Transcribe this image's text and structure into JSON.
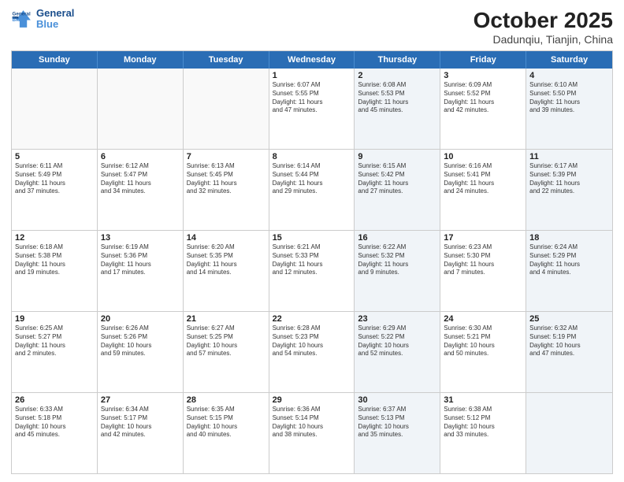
{
  "header": {
    "logo_line1": "General",
    "logo_line2": "Blue",
    "month": "October 2025",
    "location": "Dadunqiu, Tianjin, China"
  },
  "weekdays": [
    "Sunday",
    "Monday",
    "Tuesday",
    "Wednesday",
    "Thursday",
    "Friday",
    "Saturday"
  ],
  "rows": [
    [
      {
        "day": "",
        "info": "",
        "shaded": false,
        "empty": true
      },
      {
        "day": "",
        "info": "",
        "shaded": false,
        "empty": true
      },
      {
        "day": "",
        "info": "",
        "shaded": false,
        "empty": true
      },
      {
        "day": "1",
        "info": "Sunrise: 6:07 AM\nSunset: 5:55 PM\nDaylight: 11 hours\nand 47 minutes.",
        "shaded": false,
        "empty": false
      },
      {
        "day": "2",
        "info": "Sunrise: 6:08 AM\nSunset: 5:53 PM\nDaylight: 11 hours\nand 45 minutes.",
        "shaded": true,
        "empty": false
      },
      {
        "day": "3",
        "info": "Sunrise: 6:09 AM\nSunset: 5:52 PM\nDaylight: 11 hours\nand 42 minutes.",
        "shaded": false,
        "empty": false
      },
      {
        "day": "4",
        "info": "Sunrise: 6:10 AM\nSunset: 5:50 PM\nDaylight: 11 hours\nand 39 minutes.",
        "shaded": true,
        "empty": false
      }
    ],
    [
      {
        "day": "5",
        "info": "Sunrise: 6:11 AM\nSunset: 5:49 PM\nDaylight: 11 hours\nand 37 minutes.",
        "shaded": false,
        "empty": false
      },
      {
        "day": "6",
        "info": "Sunrise: 6:12 AM\nSunset: 5:47 PM\nDaylight: 11 hours\nand 34 minutes.",
        "shaded": false,
        "empty": false
      },
      {
        "day": "7",
        "info": "Sunrise: 6:13 AM\nSunset: 5:45 PM\nDaylight: 11 hours\nand 32 minutes.",
        "shaded": false,
        "empty": false
      },
      {
        "day": "8",
        "info": "Sunrise: 6:14 AM\nSunset: 5:44 PM\nDaylight: 11 hours\nand 29 minutes.",
        "shaded": false,
        "empty": false
      },
      {
        "day": "9",
        "info": "Sunrise: 6:15 AM\nSunset: 5:42 PM\nDaylight: 11 hours\nand 27 minutes.",
        "shaded": true,
        "empty": false
      },
      {
        "day": "10",
        "info": "Sunrise: 6:16 AM\nSunset: 5:41 PM\nDaylight: 11 hours\nand 24 minutes.",
        "shaded": false,
        "empty": false
      },
      {
        "day": "11",
        "info": "Sunrise: 6:17 AM\nSunset: 5:39 PM\nDaylight: 11 hours\nand 22 minutes.",
        "shaded": true,
        "empty": false
      }
    ],
    [
      {
        "day": "12",
        "info": "Sunrise: 6:18 AM\nSunset: 5:38 PM\nDaylight: 11 hours\nand 19 minutes.",
        "shaded": false,
        "empty": false
      },
      {
        "day": "13",
        "info": "Sunrise: 6:19 AM\nSunset: 5:36 PM\nDaylight: 11 hours\nand 17 minutes.",
        "shaded": false,
        "empty": false
      },
      {
        "day": "14",
        "info": "Sunrise: 6:20 AM\nSunset: 5:35 PM\nDaylight: 11 hours\nand 14 minutes.",
        "shaded": false,
        "empty": false
      },
      {
        "day": "15",
        "info": "Sunrise: 6:21 AM\nSunset: 5:33 PM\nDaylight: 11 hours\nand 12 minutes.",
        "shaded": false,
        "empty": false
      },
      {
        "day": "16",
        "info": "Sunrise: 6:22 AM\nSunset: 5:32 PM\nDaylight: 11 hours\nand 9 minutes.",
        "shaded": true,
        "empty": false
      },
      {
        "day": "17",
        "info": "Sunrise: 6:23 AM\nSunset: 5:30 PM\nDaylight: 11 hours\nand 7 minutes.",
        "shaded": false,
        "empty": false
      },
      {
        "day": "18",
        "info": "Sunrise: 6:24 AM\nSunset: 5:29 PM\nDaylight: 11 hours\nand 4 minutes.",
        "shaded": true,
        "empty": false
      }
    ],
    [
      {
        "day": "19",
        "info": "Sunrise: 6:25 AM\nSunset: 5:27 PM\nDaylight: 11 hours\nand 2 minutes.",
        "shaded": false,
        "empty": false
      },
      {
        "day": "20",
        "info": "Sunrise: 6:26 AM\nSunset: 5:26 PM\nDaylight: 10 hours\nand 59 minutes.",
        "shaded": false,
        "empty": false
      },
      {
        "day": "21",
        "info": "Sunrise: 6:27 AM\nSunset: 5:25 PM\nDaylight: 10 hours\nand 57 minutes.",
        "shaded": false,
        "empty": false
      },
      {
        "day": "22",
        "info": "Sunrise: 6:28 AM\nSunset: 5:23 PM\nDaylight: 10 hours\nand 54 minutes.",
        "shaded": false,
        "empty": false
      },
      {
        "day": "23",
        "info": "Sunrise: 6:29 AM\nSunset: 5:22 PM\nDaylight: 10 hours\nand 52 minutes.",
        "shaded": true,
        "empty": false
      },
      {
        "day": "24",
        "info": "Sunrise: 6:30 AM\nSunset: 5:21 PM\nDaylight: 10 hours\nand 50 minutes.",
        "shaded": false,
        "empty": false
      },
      {
        "day": "25",
        "info": "Sunrise: 6:32 AM\nSunset: 5:19 PM\nDaylight: 10 hours\nand 47 minutes.",
        "shaded": true,
        "empty": false
      }
    ],
    [
      {
        "day": "26",
        "info": "Sunrise: 6:33 AM\nSunset: 5:18 PM\nDaylight: 10 hours\nand 45 minutes.",
        "shaded": false,
        "empty": false
      },
      {
        "day": "27",
        "info": "Sunrise: 6:34 AM\nSunset: 5:17 PM\nDaylight: 10 hours\nand 42 minutes.",
        "shaded": false,
        "empty": false
      },
      {
        "day": "28",
        "info": "Sunrise: 6:35 AM\nSunset: 5:15 PM\nDaylight: 10 hours\nand 40 minutes.",
        "shaded": false,
        "empty": false
      },
      {
        "day": "29",
        "info": "Sunrise: 6:36 AM\nSunset: 5:14 PM\nDaylight: 10 hours\nand 38 minutes.",
        "shaded": false,
        "empty": false
      },
      {
        "day": "30",
        "info": "Sunrise: 6:37 AM\nSunset: 5:13 PM\nDaylight: 10 hours\nand 35 minutes.",
        "shaded": true,
        "empty": false
      },
      {
        "day": "31",
        "info": "Sunrise: 6:38 AM\nSunset: 5:12 PM\nDaylight: 10 hours\nand 33 minutes.",
        "shaded": false,
        "empty": false
      },
      {
        "day": "",
        "info": "",
        "shaded": true,
        "empty": true
      }
    ]
  ]
}
